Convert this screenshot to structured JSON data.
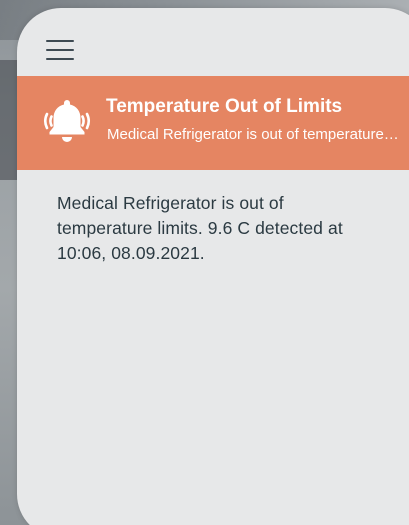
{
  "menu": {
    "icon": "hamburger-menu-icon"
  },
  "alert": {
    "icon": "bell-ringing-icon",
    "title": "Temperature Out of Limits",
    "subtitle": "Medical Refrigerator is out of temperature limits. 9.6 C detected at 10:06, 08.09.2021.",
    "message": "Medical Refrigerator is out of temperature limits. 9.6 C detected at 10:06, 08.09.2021."
  },
  "colors": {
    "banner": "#e58562",
    "card_background": "#e7e8e9",
    "message_text": "#2b3a42",
    "menu_icon": "#3d4a52"
  }
}
